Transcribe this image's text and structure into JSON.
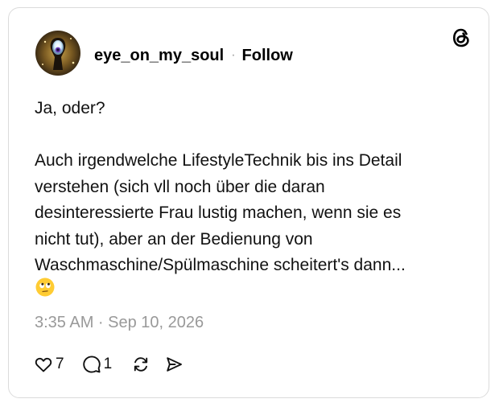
{
  "post": {
    "username": "eye_on_my_soul",
    "separator": "·",
    "follow_label": "Follow",
    "body": "Ja, oder?\n\nAuch irgendwelche LifestyleTechnik bis ins Detail\nverstehen (sich vll noch über die daran\ndesinteressierte Frau lustig machen, wenn sie es\nnicht tut), aber an der Bedienung von\nWaschmaschine/Spülmaschine scheitert's dann...",
    "emoji": "🙄",
    "timestamp": "3:35 AM · Sep 10, 2026"
  },
  "actions": {
    "likes_count": "7",
    "replies_count": "1"
  },
  "icons": {
    "logo": "threads-logo-icon",
    "like": "heart-icon",
    "reply": "speech-bubble-icon",
    "repost": "repost-icon",
    "share": "send-icon",
    "emoji": "face-with-rolling-eyes"
  },
  "colors": {
    "text": "#111111",
    "muted": "#999999",
    "border": "#dbdbdb",
    "background": "#ffffff"
  }
}
